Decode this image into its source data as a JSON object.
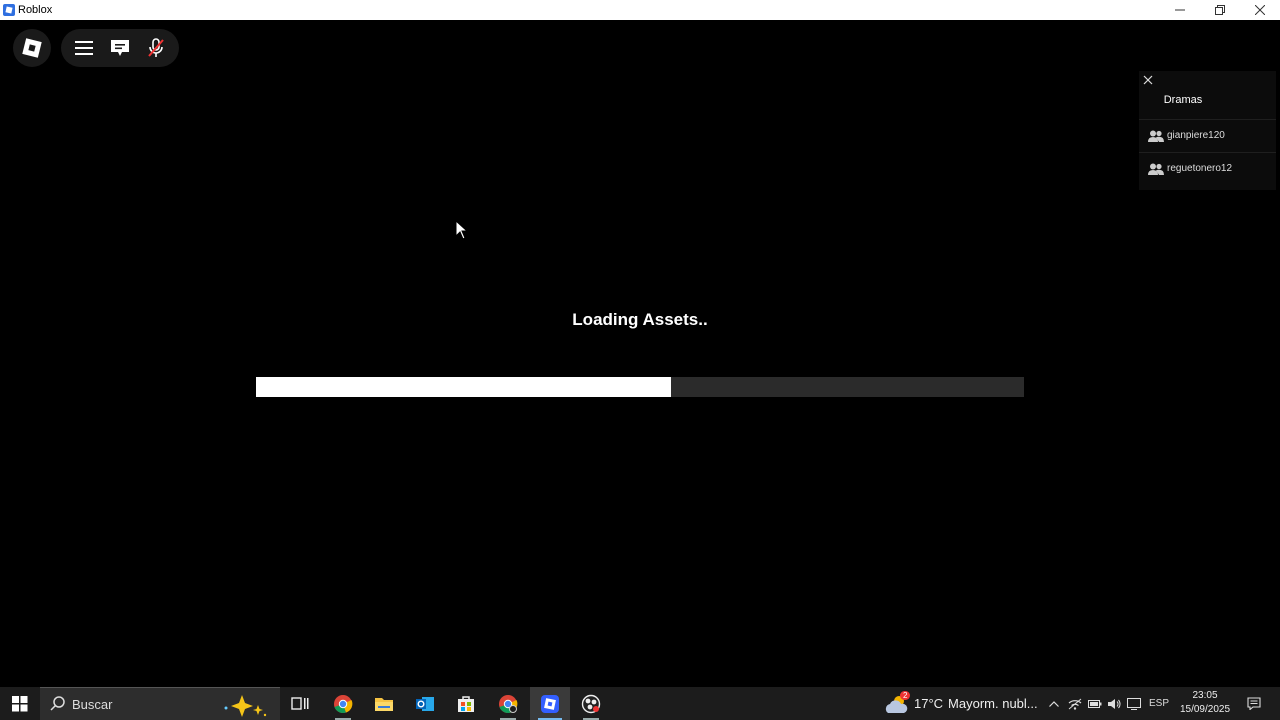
{
  "window": {
    "title": "Roblox"
  },
  "game": {
    "loading_text": "Loading Assets..",
    "progress": 0.54
  },
  "panel": {
    "heading": "Dramas",
    "players": [
      "gianpiere120",
      "reguetonero12"
    ]
  },
  "taskbar": {
    "search_placeholder": "Buscar",
    "weather_temp": "17°C",
    "weather_desc": "Mayorm. nubl...",
    "weather_badge": "2",
    "language": "ESP",
    "time": "23:05",
    "date": "15/09/2025"
  },
  "colors": {
    "accent": "#76b9ed",
    "progress_fill": "#ffffff",
    "progress_track": "#2b2b2b"
  }
}
